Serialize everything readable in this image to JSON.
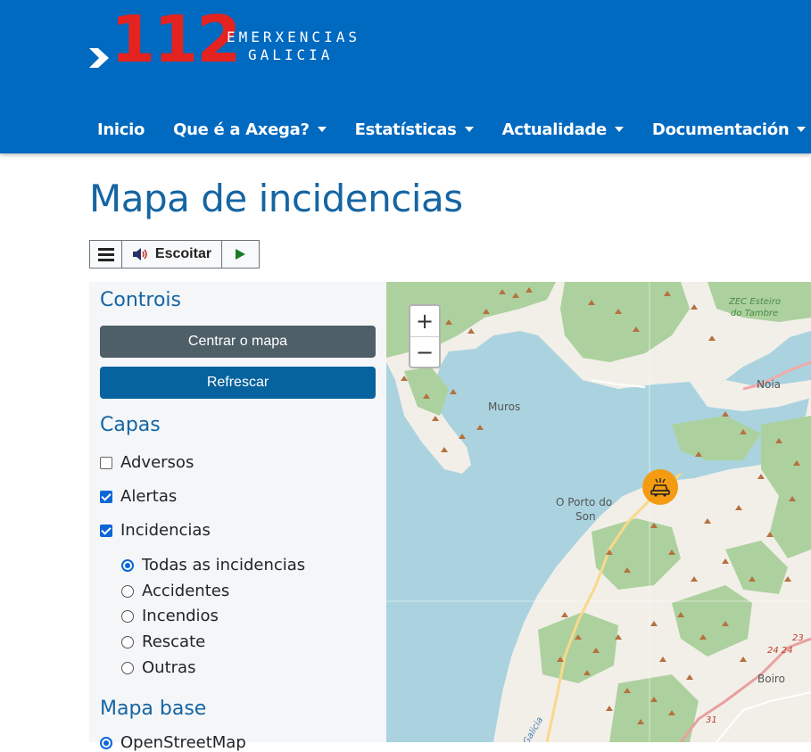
{
  "header": {
    "logo": {
      "number": "112",
      "line1": "EMERXENCIAS",
      "line2": "GALICIA"
    },
    "nav": [
      {
        "label": "Inicio",
        "dropdown": false
      },
      {
        "label": "Que é a Axega?",
        "dropdown": true
      },
      {
        "label": "Estatísticas",
        "dropdown": true
      },
      {
        "label": "Actualidade",
        "dropdown": true
      },
      {
        "label": "Documentación",
        "dropdown": true
      }
    ]
  },
  "page": {
    "title": "Mapa de incidencias"
  },
  "readspeaker": {
    "listen_label": "Escoitar"
  },
  "sidebar": {
    "controls_heading": "Controis",
    "center_button": "Centrar o mapa",
    "refresh_button": "Refrescar",
    "layers_heading": "Capas",
    "layers": [
      {
        "label": "Adversos",
        "checked": false
      },
      {
        "label": "Alertas",
        "checked": true
      },
      {
        "label": "Incidencias",
        "checked": true
      }
    ],
    "incident_types": [
      {
        "label": "Todas as incidencias",
        "selected": true
      },
      {
        "label": "Accidentes",
        "selected": false
      },
      {
        "label": "Incendios",
        "selected": false
      },
      {
        "label": "Rescate",
        "selected": false
      },
      {
        "label": "Outras",
        "selected": false
      }
    ],
    "basemap_heading": "Mapa base",
    "basemap_option": "OpenStreetMap"
  },
  "map": {
    "zoom_in": "+",
    "zoom_out": "−",
    "labels": {
      "zec": "ZEC Esteiro",
      "zec2": "do Tambre",
      "noia": "Noia",
      "muros": "Muros",
      "porto1": "O Porto do",
      "porto2": "Son",
      "boiro": "Boiro",
      "galicia": "Galicia",
      "r23": "23",
      "r2424": "24 24",
      "r31": "31"
    },
    "colors": {
      "sea": "#aad3df",
      "land": "#f2efe9",
      "forest": "#add19e",
      "peak": "#b5713f",
      "marker": "#f39c12"
    }
  }
}
